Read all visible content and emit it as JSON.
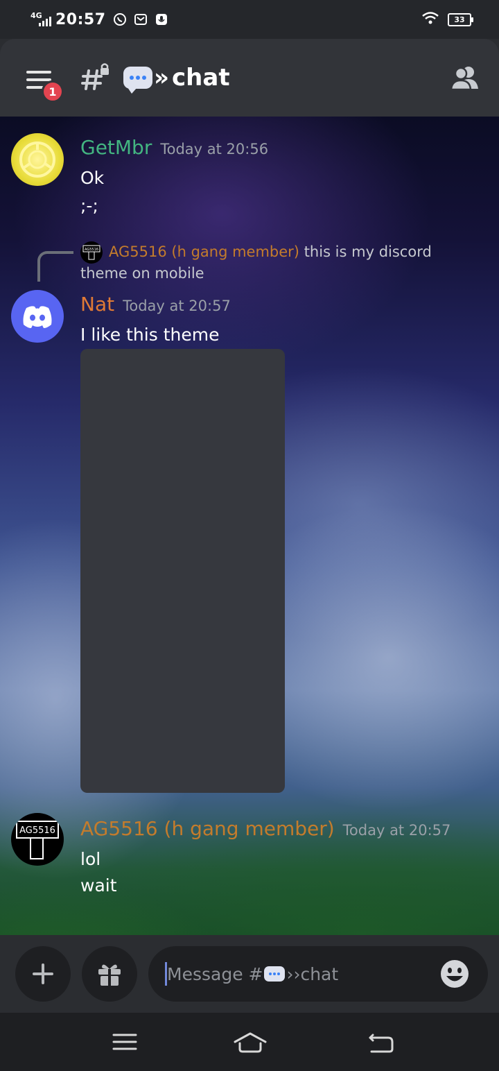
{
  "status_bar": {
    "network": "4G",
    "time": "20:57",
    "battery": "33",
    "icons": [
      "whatsapp-icon",
      "mail-icon",
      "mic-icon",
      "wifi-icon",
      "battery-icon"
    ]
  },
  "header": {
    "badge_count": "1",
    "channel_name": "chat",
    "icons": [
      "hamburger-menu-icon",
      "locked-hash-icon",
      "speech-bubble-emoji-icon",
      "members-icon"
    ]
  },
  "messages": [
    {
      "author": "GetMbr",
      "timestamp": "Today at 20:56",
      "author_color": "#43b581",
      "lines": [
        "Ok",
        ";-;"
      ]
    },
    {
      "reply": {
        "author": "AG5516 (h gang member)",
        "text": "this is my discord theme on mobile",
        "avatar_text": "AG5516"
      },
      "author": "Nat",
      "timestamp": "Today at 20:57",
      "author_color": "#e07a35",
      "lines": [
        "I like this theme"
      ]
    },
    {
      "author": "AG5516 (h gang member)",
      "timestamp": "Today at 20:57",
      "author_color": "#c47c2c",
      "avatar_text": "AG5516",
      "lines": [
        "lol",
        "wait"
      ]
    }
  ],
  "composer": {
    "placeholder_prefix": "Message #",
    "placeholder_channel": "chat",
    "icons": [
      "plus-icon",
      "gift-icon",
      "emoji-icon"
    ]
  },
  "nav": {
    "icons": [
      "recent-apps-icon",
      "home-icon",
      "back-icon"
    ]
  },
  "colors": {
    "accent": "#7289da",
    "badge": "#e34450",
    "header_bg": "#323439",
    "attachment_bg": "#36383e"
  }
}
